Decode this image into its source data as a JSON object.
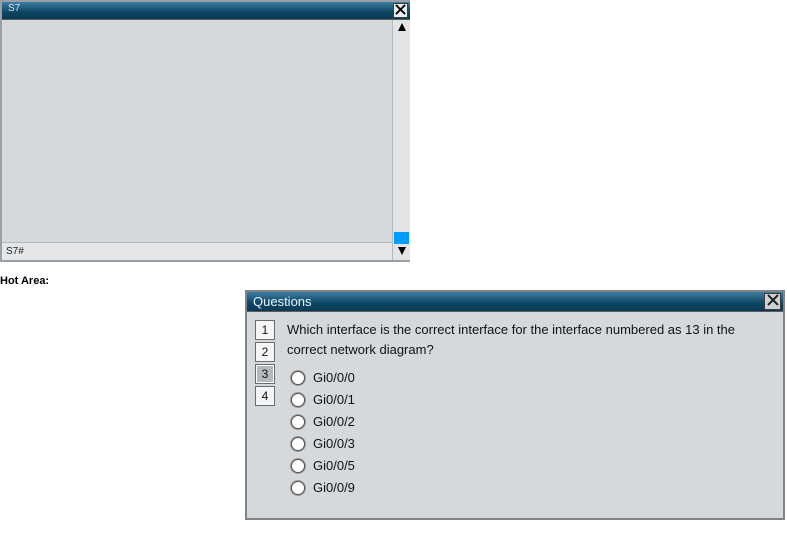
{
  "terminal": {
    "title": "S7",
    "prompt": "S7#"
  },
  "hot_area_label": "Hot Area:",
  "questions": {
    "title": "Questions",
    "nav": [
      {
        "num": "1",
        "selected": false
      },
      {
        "num": "2",
        "selected": false
      },
      {
        "num": "3",
        "selected": true
      },
      {
        "num": "4",
        "selected": false
      }
    ],
    "question_text": "Which interface is the correct interface for the interface numbered as 13 in the correct network diagram?",
    "options": [
      "Gi0/0/0",
      "Gi0/0/1",
      "Gi0/0/2",
      "Gi0/0/3",
      "Gi0/0/5",
      "Gi0/0/9"
    ]
  }
}
